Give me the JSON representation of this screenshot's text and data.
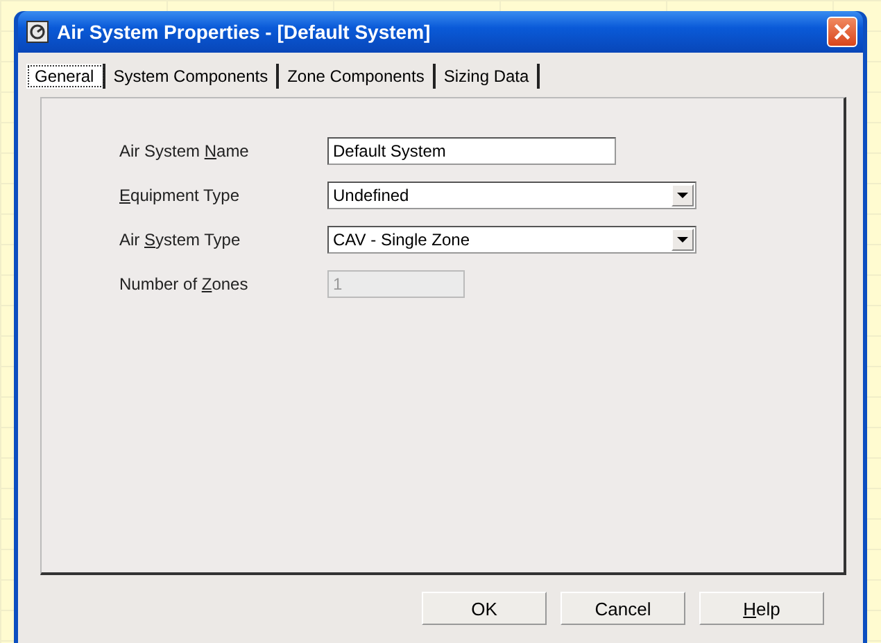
{
  "window": {
    "title": "Air System Properties - [Default System]"
  },
  "tabs": [
    {
      "label": "General",
      "selected": true
    },
    {
      "label": "System Components",
      "selected": false
    },
    {
      "label": "Zone Components",
      "selected": false
    },
    {
      "label": "Sizing Data",
      "selected": false
    }
  ],
  "fields": [
    {
      "kind": "text",
      "label": {
        "pre": "Air System ",
        "key": "N",
        "post": "ame"
      },
      "value": "Default System",
      "disabled": false
    },
    {
      "kind": "dropdown",
      "label": {
        "key": "E",
        "post": "quipment Type"
      },
      "value": "Undefined",
      "disabled": false
    },
    {
      "kind": "dropdown",
      "label": {
        "pre": "Air ",
        "key": "S",
        "post": "ystem Type"
      },
      "value": "CAV - Single Zone",
      "disabled": false
    },
    {
      "kind": "text",
      "label": {
        "pre": "Number of ",
        "key": "Z",
        "post": "ones"
      },
      "value": "1",
      "disabled": true
    }
  ],
  "buttons": [
    {
      "label": {
        "post": "OK"
      }
    },
    {
      "label": {
        "post": "Cancel"
      }
    },
    {
      "label": {
        "key": "H",
        "post": "elp"
      }
    }
  ]
}
